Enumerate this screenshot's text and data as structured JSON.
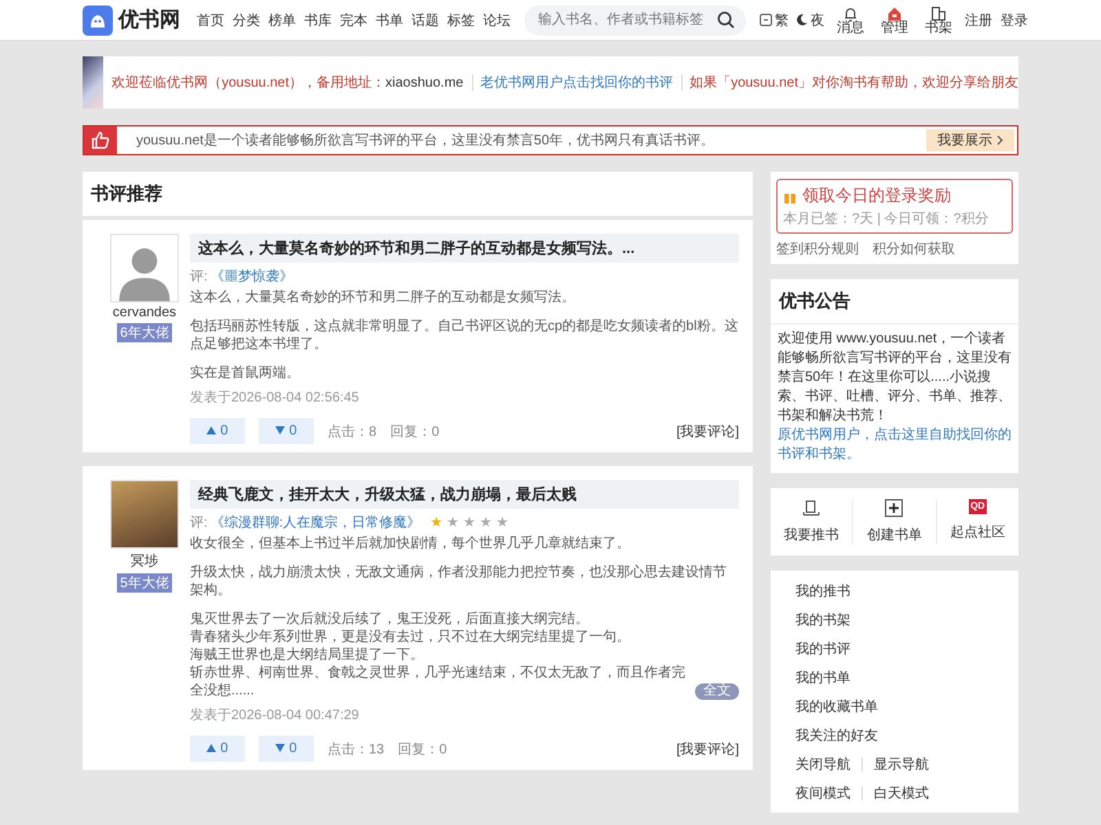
{
  "header": {
    "logo": "优书网",
    "nav": [
      {
        "label": "首页"
      },
      {
        "label": "分类"
      },
      {
        "label": "榜单"
      },
      {
        "label": "书库"
      },
      {
        "label": "完本"
      },
      {
        "label": "书单"
      },
      {
        "label": "话题"
      },
      {
        "label": "标签"
      },
      {
        "label": "论坛"
      }
    ],
    "search": {
      "placeholder": "输入书名、作者或书籍标签"
    },
    "toggles": [
      {
        "kind": "traditional",
        "label": "繁"
      },
      {
        "kind": "night",
        "label": "夜"
      }
    ],
    "icons": [
      {
        "kind": "bell",
        "label": "消息"
      },
      {
        "kind": "house",
        "label": "管理"
      },
      {
        "kind": "shelf",
        "label": "书架"
      }
    ],
    "auth": [
      "注册",
      "登录"
    ]
  },
  "banner": {
    "links": [
      {
        "kind": "welcome",
        "text": "欢迎莅临优书网（yousuu.net），备用地址：",
        "extra": "xiaoshuo.me"
      },
      {
        "kind": "link",
        "text": "老优书网用户点击找回你的书评"
      },
      {
        "kind": "share",
        "text": "如果「yousuu.net」对你淘书有帮助，欢迎分享给朋友"
      }
    ]
  },
  "notice": {
    "text": "yousuu.net是一个读者能够畅所欲言写书评的平台，这里没有禁言50年，优书网只有真话书评。",
    "button": "我要展示"
  },
  "reviews_section": {
    "title": "书评推荐",
    "reviews": [
      {
        "avatar": {
          "kind": "silhouette"
        },
        "user": "cervandes",
        "badge": "6年大佬",
        "title": "这本么，大量莫名奇妙的环节和男二胖子的互动都是女频写法。...",
        "prefix": "评:",
        "book": "《噩梦惊袭》",
        "paragraphs": [
          [
            "这本么，大量莫名奇妙的环节和男二胖子的互动都是女频写法。"
          ],
          [
            "包括玛丽苏性转版，这点就非常明显了。自己书评区说的无cp的都是吃女频读者的bl粉。这点足够把这本书埋了。"
          ],
          [
            "实在是首鼠两端。"
          ]
        ],
        "date": "发表于2026-08-04 02:56:45",
        "up": "0",
        "down": "0",
        "clicks": "点击：8",
        "replies": "回复：0",
        "comment": "[我要评论]"
      },
      {
        "avatar": {
          "kind": "photo"
        },
        "user": "冥埗",
        "badge": "5年大佬",
        "title": "经典飞鹿文，挂开太大，升级太猛，战力崩塌，最后太贱",
        "prefix": "评:",
        "book": "《综漫群聊:人在魔宗，日常修魔》",
        "stars": 1,
        "paragraphs": [
          [
            "收女很全，但基本上书过半后就加快剧情，每个世界几乎几章就结束了。"
          ],
          [
            "升级太快，战力崩溃太快，无敌文通病，作者没那能力把控节奏，也没那心思去建设情节架构。"
          ],
          [
            "鬼灭世界去了一次后就没后续了，鬼王没死，后面直接大纲完结。",
            "青春猪头少年系列世界，更是没有去过，只不过在大纲完结里提了一句。",
            "海贼王世界也是大纲结局里提了一下。",
            "斩赤世界、柯南世界、食戟之灵世界，几乎光速结束，不仅太无敌了，而且作者完全没想......"
          ]
        ],
        "more": "全文",
        "date": "发表于2026-08-04 00:47:29",
        "up": "0",
        "down": "0",
        "clicks": "点击：13",
        "replies": "回复：0",
        "comment": "[我要评论]"
      }
    ]
  },
  "sidebar": {
    "reward": {
      "title": "领取今日的登录奖励",
      "sub": "本月已签：?天 | 今日可领：?积分",
      "links": [
        "签到积分规则",
        "积分如何获取"
      ]
    },
    "announcement": {
      "title": "优书公告",
      "text": "欢迎使用 www.yousuu.net，一个读者能够畅所欲言写书评的平台，这里没有禁言50年！在这里你可以.....小说搜索、书评、吐槽、评分、书单、推荐、书架和解决书荒！",
      "link": "原优书网用户，点击这里自助找回你的书评和书架。"
    },
    "actions": [
      {
        "kind": "book",
        "label": "我要推书"
      },
      {
        "kind": "plus",
        "label": "创建书单"
      },
      {
        "kind": "qd",
        "label": "起点社区",
        "badge": "QD"
      }
    ],
    "menu": [
      [
        "我的推书"
      ],
      [
        "我的书架"
      ],
      [
        "我的书评"
      ],
      [
        "我的书单"
      ],
      [
        "我的收藏书单"
      ],
      [
        "我关注的好友"
      ],
      [
        "关闭导航",
        "显示导航"
      ],
      [
        "夜间模式",
        "白天模式"
      ]
    ]
  }
}
